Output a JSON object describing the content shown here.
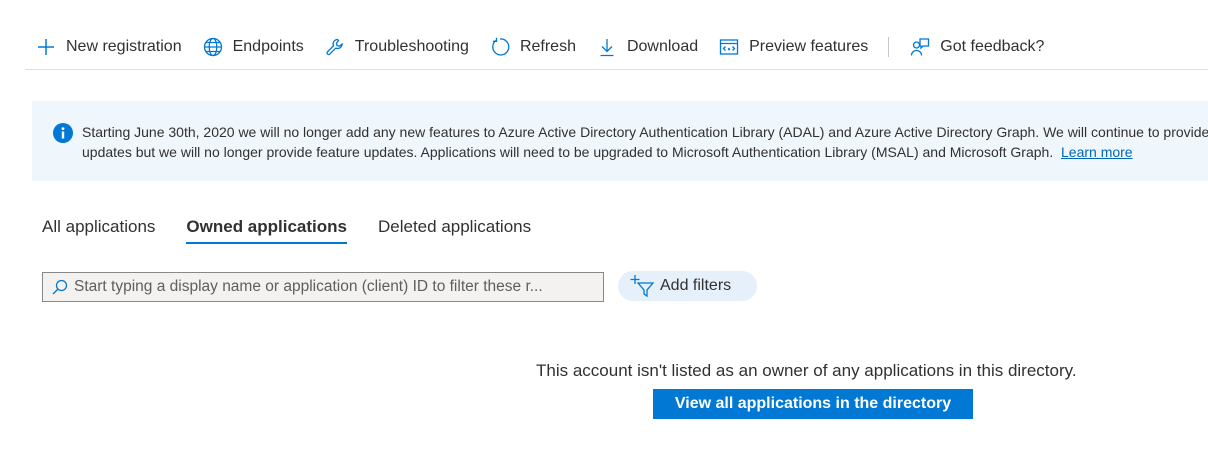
{
  "toolbar": {
    "items": [
      {
        "label": "New registration",
        "icon": "plus-icon"
      },
      {
        "label": "Endpoints",
        "icon": "globe-icon"
      },
      {
        "label": "Troubleshooting",
        "icon": "wrench-icon"
      },
      {
        "label": "Refresh",
        "icon": "refresh-icon"
      },
      {
        "label": "Download",
        "icon": "download-icon"
      },
      {
        "label": "Preview features",
        "icon": "preview-icon"
      }
    ],
    "feedback": {
      "label": "Got feedback?",
      "icon": "feedback-icon"
    }
  },
  "banner": {
    "icon": "info-icon",
    "line1": "Starting June 30th, 2020 we will no longer add any new features to Azure Active Directory Authentication Library (ADAL) and Azure Active Directory Graph. We will continue to provide technical support and security",
    "line2": "updates but we will no longer provide feature updates. Applications will need to be upgraded to Microsoft Authentication Library (MSAL) and Microsoft Graph.",
    "link": "Learn more"
  },
  "tabs": [
    {
      "label": "All applications",
      "active": false
    },
    {
      "label": "Owned applications",
      "active": true
    },
    {
      "label": "Deleted applications",
      "active": false
    }
  ],
  "search": {
    "placeholder": "Start typing a display name or application (client) ID to filter these r...",
    "value": ""
  },
  "filters": {
    "label": "Add filters"
  },
  "empty_state": {
    "message": "This account isn't listed as an owner of any applications in this directory.",
    "button": "View all applications in the directory"
  },
  "colors": {
    "accent": "#0078d4",
    "banner_bg": "#eff6fc",
    "link": "#0067b8"
  }
}
